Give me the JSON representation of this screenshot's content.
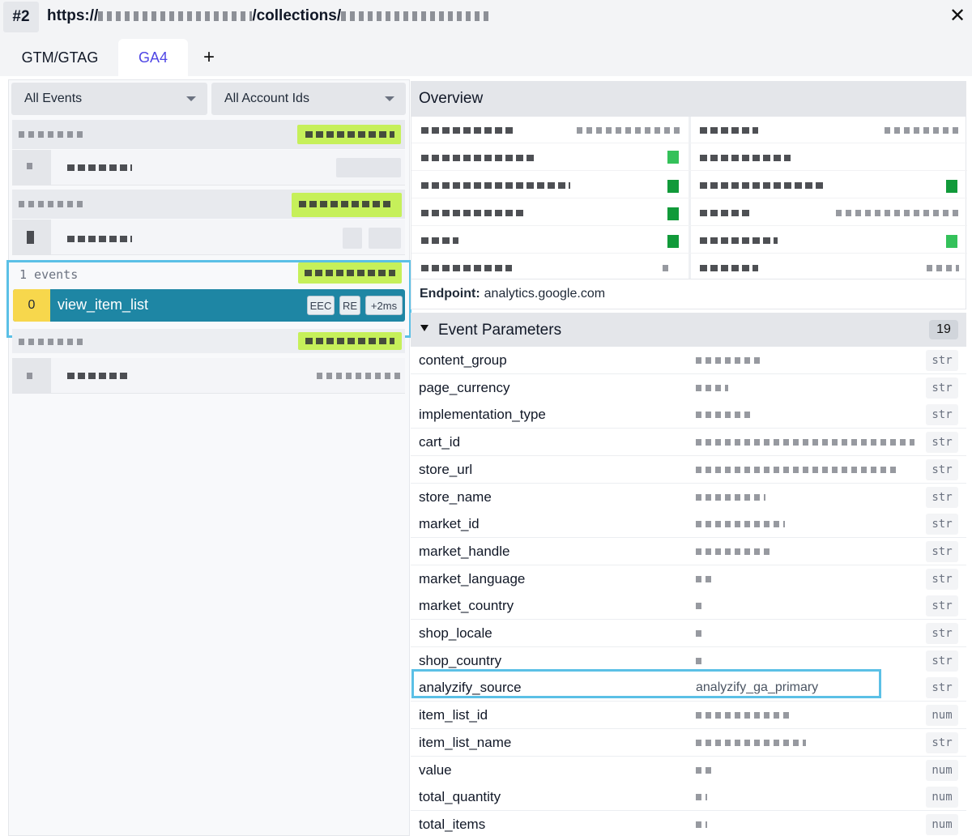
{
  "titlebar": {
    "tab_number": "#2",
    "url_prefix": "https://",
    "url_path": "/collections/"
  },
  "tabs": [
    {
      "label": "GTM/GTAG",
      "active": false
    },
    {
      "label": "GA4",
      "active": true
    },
    {
      "label": "+",
      "active": false
    }
  ],
  "filters": {
    "events": "All Events",
    "accounts": "All Account Ids"
  },
  "event_list": {
    "selected_group": {
      "count_label": "1 events",
      "event": {
        "index": "0",
        "name": "view_item_list",
        "badges": [
          "EEC",
          "RE",
          "+2ms"
        ]
      }
    }
  },
  "overview": {
    "title": "Overview",
    "endpoint_label": "Endpoint:",
    "endpoint_value": "analytics.google.com"
  },
  "event_parameters": {
    "title": "Event Parameters",
    "count": "19",
    "rows": [
      {
        "key": "content_group",
        "value": "",
        "type": "str"
      },
      {
        "key": "page_currency",
        "value": "",
        "type": "str"
      },
      {
        "key": "implementation_type",
        "value": "",
        "type": "str"
      },
      {
        "key": "cart_id",
        "value": "",
        "type": "str"
      },
      {
        "key": "store_url",
        "value": "",
        "type": "str"
      },
      {
        "key": "store_name",
        "value": "",
        "type": "str"
      },
      {
        "key": "market_id",
        "value": "",
        "type": "str"
      },
      {
        "key": "market_handle",
        "value": "",
        "type": "str"
      },
      {
        "key": "market_language",
        "value": "",
        "type": "str"
      },
      {
        "key": "market_country",
        "value": "",
        "type": "str"
      },
      {
        "key": "shop_locale",
        "value": "",
        "type": "str"
      },
      {
        "key": "shop_country",
        "value": "",
        "type": "str"
      },
      {
        "key": "analyzify_source",
        "value": "analyzify_ga_primary",
        "type": "str"
      },
      {
        "key": "item_list_id",
        "value": "",
        "type": "num"
      },
      {
        "key": "item_list_name",
        "value": "",
        "type": "str"
      },
      {
        "key": "value",
        "value": "",
        "type": "num"
      },
      {
        "key": "total_quantity",
        "value": "",
        "type": "num"
      },
      {
        "key": "total_items",
        "value": "",
        "type": "num"
      }
    ]
  },
  "colors": {
    "accent_tab": "#4f46e5",
    "selected_event": "#1e86a4",
    "event_index": "#f7d74c",
    "highlight_outline": "#5bc0e6",
    "account_badge": "#c6f05a",
    "status_green": "#34c15a"
  }
}
